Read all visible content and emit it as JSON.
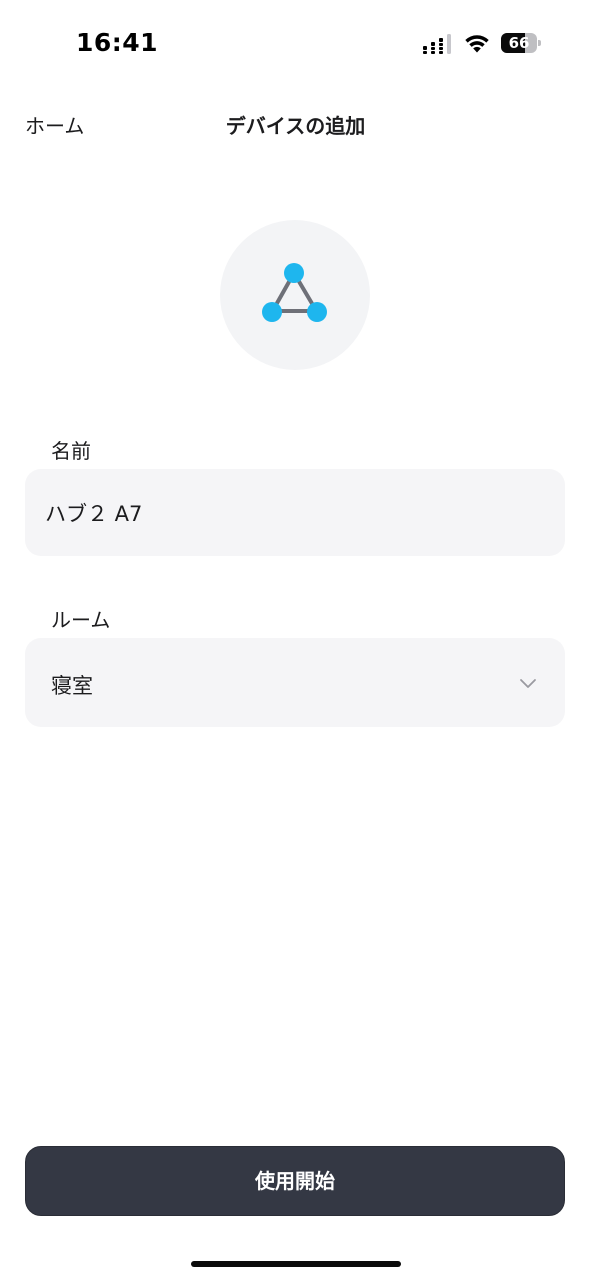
{
  "status_bar": {
    "time": "16:41",
    "battery_level": "66",
    "battery_fraction": 0.66
  },
  "nav": {
    "back_label": "ホーム",
    "title": "デバイスの追加"
  },
  "device": {
    "icon": "hub-triangle-icon",
    "icon_node_color": "#1eb6ee",
    "icon_edge_color": "#6e7078"
  },
  "form": {
    "name_label": "名前",
    "name_value": "ハブ２ A7",
    "room_label": "ルーム",
    "room_value": "寝室"
  },
  "actions": {
    "start_label": "使用開始"
  },
  "colors": {
    "button_bg": "#343844",
    "field_bg": "#f5f5f7",
    "icon_circle_bg": "#f3f4f6"
  }
}
